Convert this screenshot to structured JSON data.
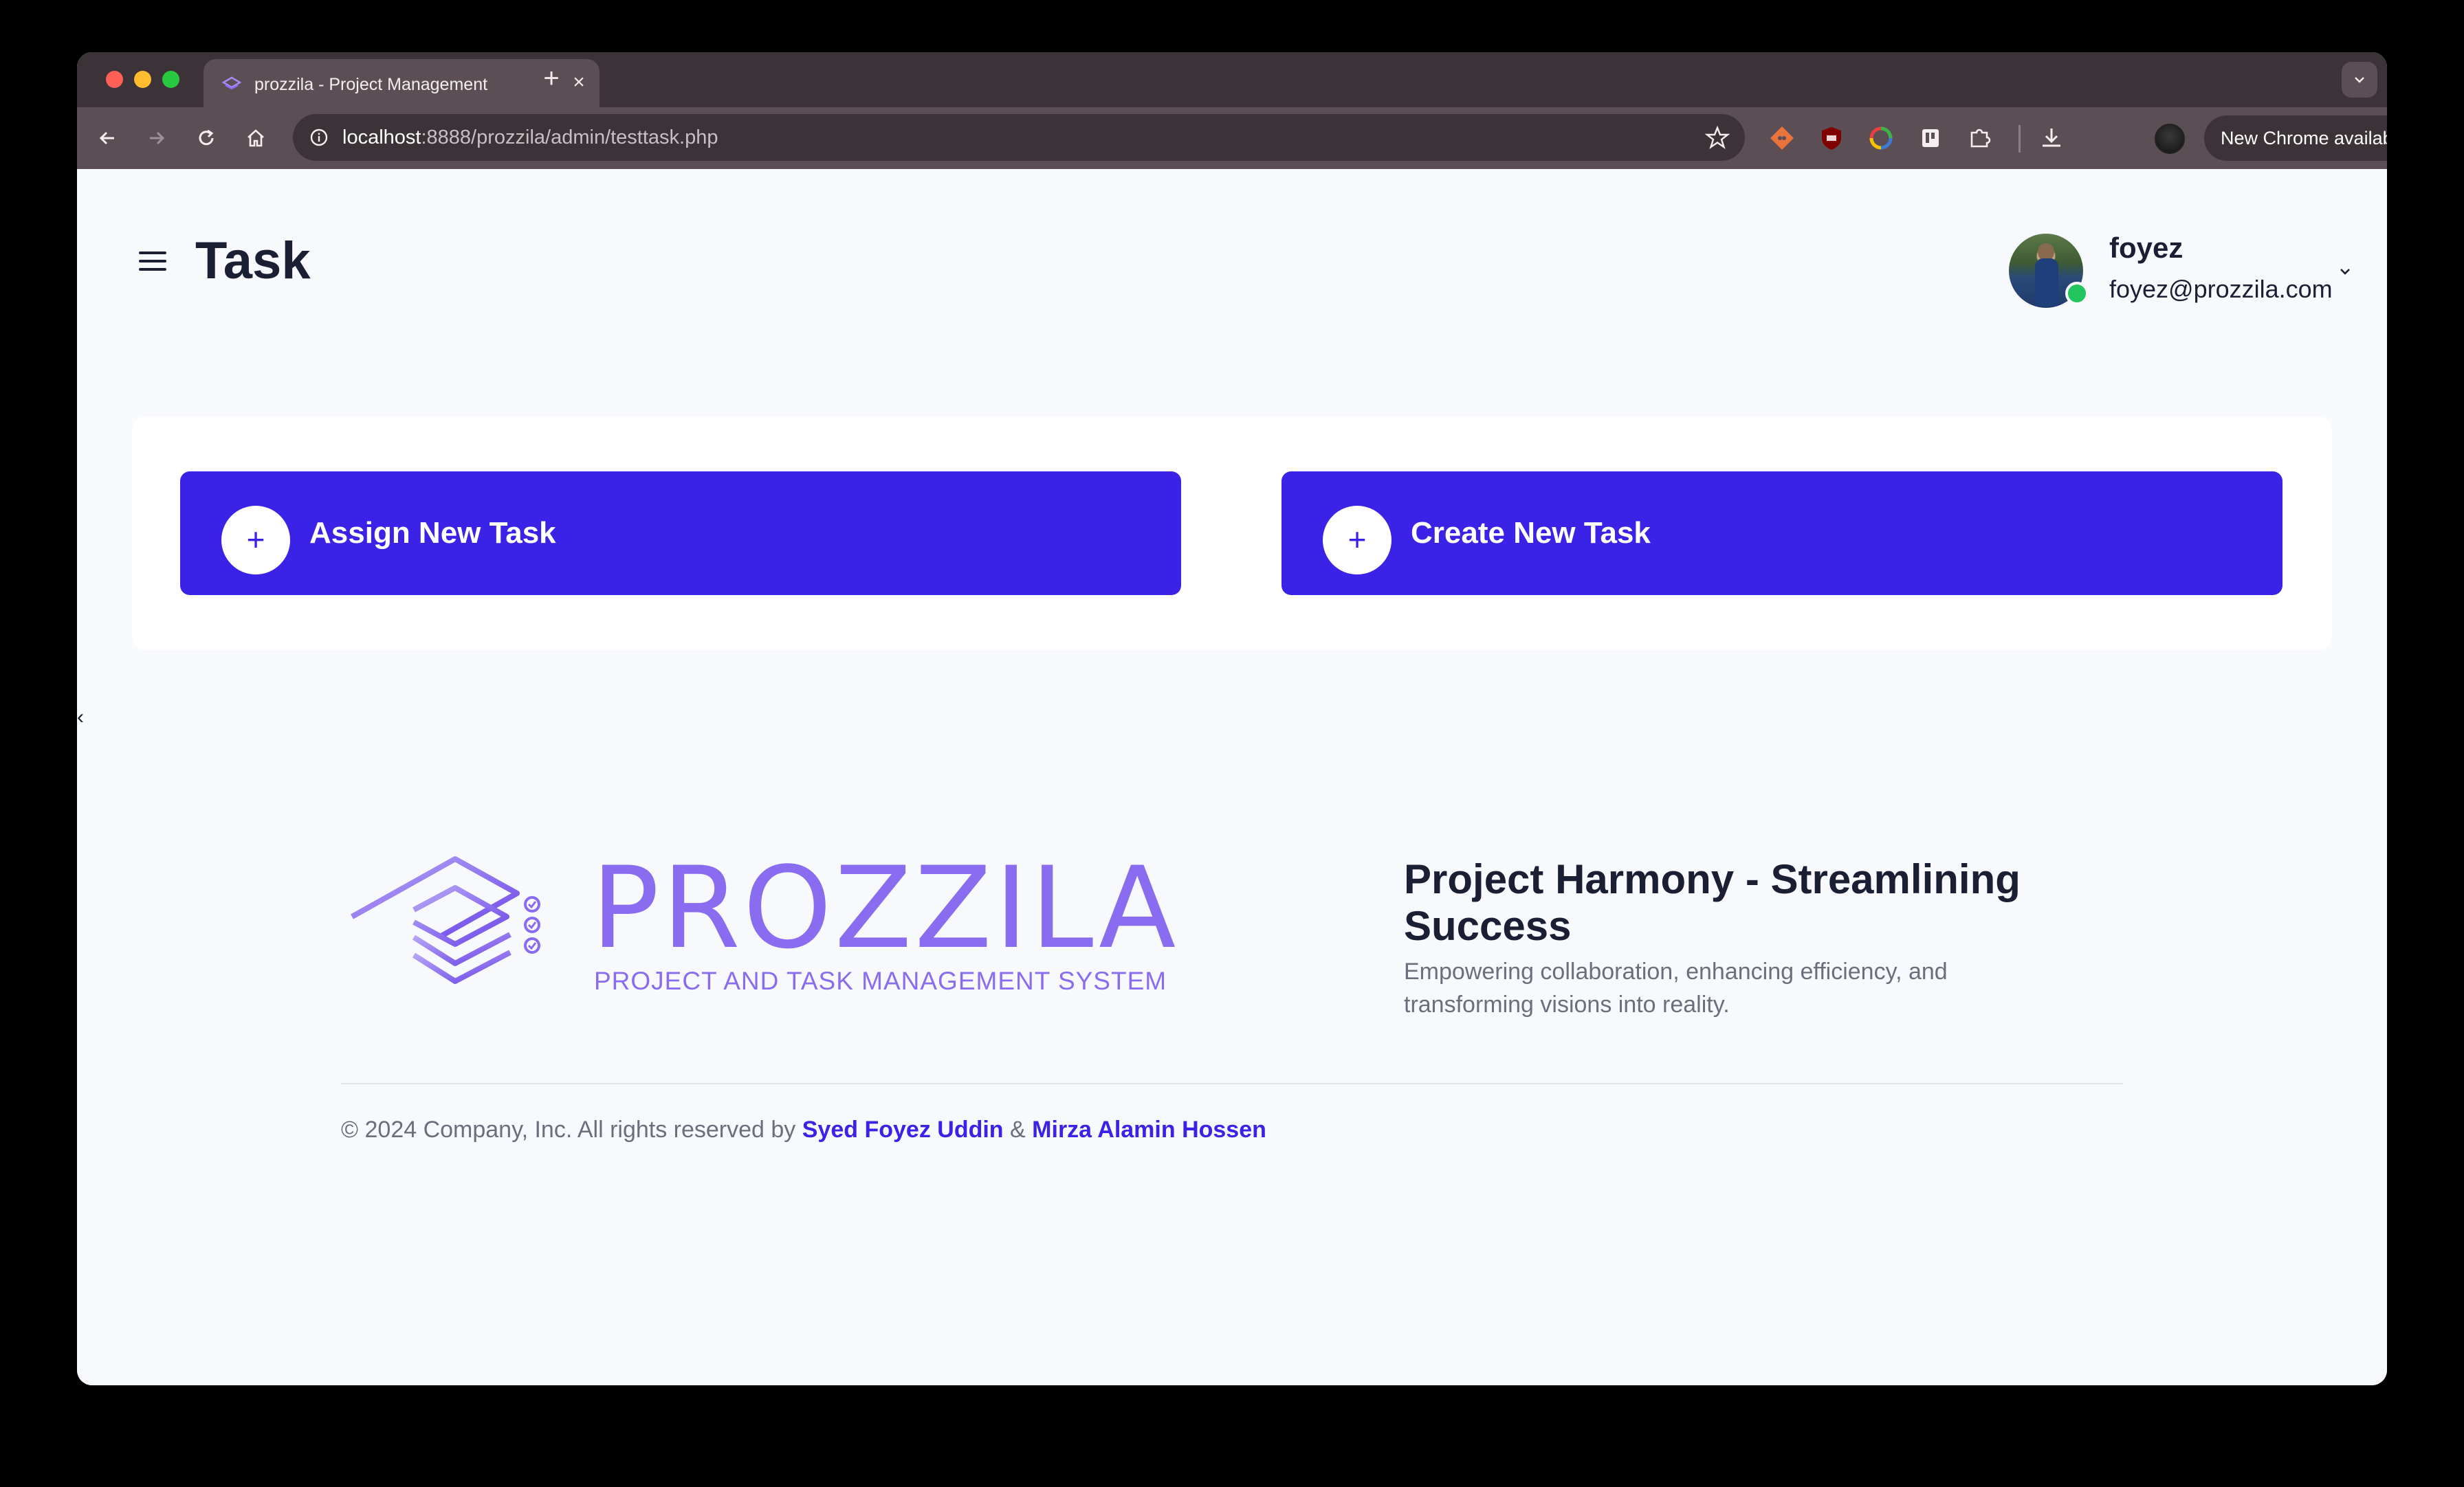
{
  "browser": {
    "tab_title": "prozzila - Project Management",
    "tab_close": "×",
    "new_tab": "+",
    "url_host": "localhost",
    "url_rest": ":8888/prozzila/admin/testtask.php",
    "update_label": "New Chrome available"
  },
  "header": {
    "title": "Task",
    "user_name": "foyez",
    "user_email": "foyez@prozzila.com"
  },
  "actions": {
    "assign_icon": "+",
    "assign_label": "Assign New Task",
    "create_icon": "+",
    "create_label": "Create New Task"
  },
  "sidebar_toggle": "‹",
  "footer": {
    "brand_name": "PROZZILA",
    "brand_subtitle": "PROJECT AND TASK MANAGEMENT SYSTEM",
    "tagline": "Project Harmony - Streamlining Success",
    "tagline_sub": "Empowering collaboration, enhancing efficiency, and transforming visions into reality.",
    "copyright_prefix": "© 2024 Company, Inc. All rights reserved by",
    "author1": "Syed Foyez Uddin",
    "ampersand": "&",
    "author2": "Mirza Alamin Hossen"
  },
  "colors": {
    "accent": "#3a22e6",
    "brand": "#8a6cf0",
    "online": "#22c55e"
  }
}
